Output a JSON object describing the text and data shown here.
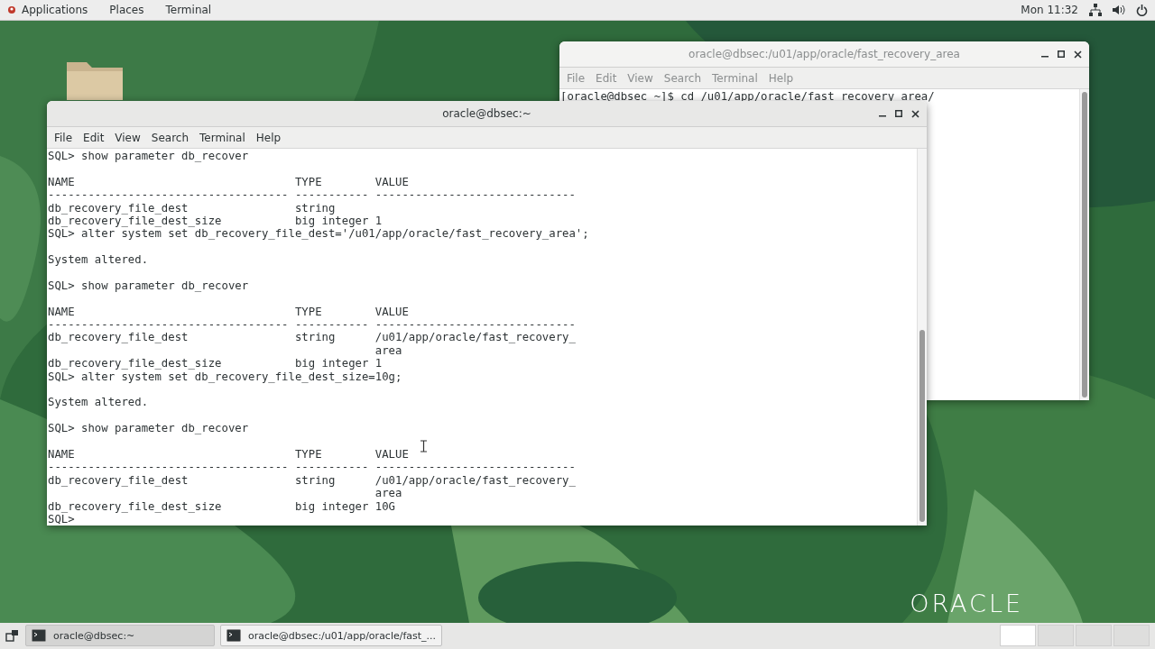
{
  "top_bar": {
    "menus": [
      {
        "label": "Applications",
        "kind": "apps"
      },
      {
        "label": "Places",
        "kind": "plain"
      },
      {
        "label": "Terminal",
        "kind": "plain"
      }
    ],
    "clock": "Mon 11:32"
  },
  "desktop": {
    "logo": "ORACLE"
  },
  "windows": [
    {
      "title": "oracle@dbsec:/u01/app/oracle/fast_recovery_area",
      "focused": false,
      "menu": [
        "File",
        "Edit",
        "View",
        "Search",
        "Terminal",
        "Help"
      ],
      "lines": [
        {
          "kind": "text",
          "text": "[oracle@dbsec ~]$ cd /u01/app/oracle/fast recovery area/"
        }
      ]
    },
    {
      "title": "oracle@dbsec:~",
      "focused": true,
      "menu": [
        "File",
        "Edit",
        "View",
        "Search",
        "Terminal",
        "Help"
      ],
      "lines": [
        {
          "kind": "text",
          "text": "SQL> show parameter db_recover"
        },
        {
          "kind": "blank"
        },
        {
          "kind": "text",
          "text": "NAME                                 TYPE        VALUE"
        },
        {
          "kind": "text",
          "text": "------------------------------------ ----------- ------------------------------"
        },
        {
          "kind": "text",
          "text": "db_recovery_file_dest                string"
        },
        {
          "kind": "text",
          "text": "db_recovery_file_dest_size           big integer 1"
        },
        {
          "kind": "text",
          "text": "SQL> alter system set db_recovery_file_dest='/u01/app/oracle/fast_recovery_area';"
        },
        {
          "kind": "blank"
        },
        {
          "kind": "text",
          "text": "System altered."
        },
        {
          "kind": "blank"
        },
        {
          "kind": "text",
          "text": "SQL> show parameter db_recover"
        },
        {
          "kind": "blank"
        },
        {
          "kind": "text",
          "text": "NAME                                 TYPE        VALUE"
        },
        {
          "kind": "text",
          "text": "------------------------------------ ----------- ------------------------------"
        },
        {
          "kind": "text",
          "text": "db_recovery_file_dest                string      /u01/app/oracle/fast_recovery_"
        },
        {
          "kind": "text",
          "text": "                                                 area"
        },
        {
          "kind": "text",
          "text": "db_recovery_file_dest_size           big integer 1"
        },
        {
          "kind": "text",
          "text": "SQL> alter system set db_recovery_file_dest_size=10g;"
        },
        {
          "kind": "blank"
        },
        {
          "kind": "text",
          "text": "System altered."
        },
        {
          "kind": "blank"
        },
        {
          "kind": "text",
          "text": "SQL> show parameter db_recover"
        },
        {
          "kind": "blank"
        },
        {
          "kind": "text",
          "text": "NAME                                 TYPE        VALUE"
        },
        {
          "kind": "text",
          "text": "------------------------------------ ----------- ------------------------------"
        },
        {
          "kind": "text",
          "text": "db_recovery_file_dest                string      /u01/app/oracle/fast_recovery_"
        },
        {
          "kind": "text",
          "text": "                                                 area"
        },
        {
          "kind": "text",
          "text": "db_recovery_file_dest_size           big integer 10G"
        },
        {
          "kind": "text",
          "text": "SQL>"
        }
      ]
    }
  ],
  "taskbar": {
    "tasks": [
      {
        "label": "oracle@dbsec:~",
        "selected": true
      },
      {
        "label": "oracle@dbsec:/u01/app/oracle/fast_...",
        "selected": false
      }
    ],
    "workspaces": [
      {
        "selected": true
      },
      {
        "selected": false
      },
      {
        "selected": false
      },
      {
        "selected": false
      }
    ]
  }
}
